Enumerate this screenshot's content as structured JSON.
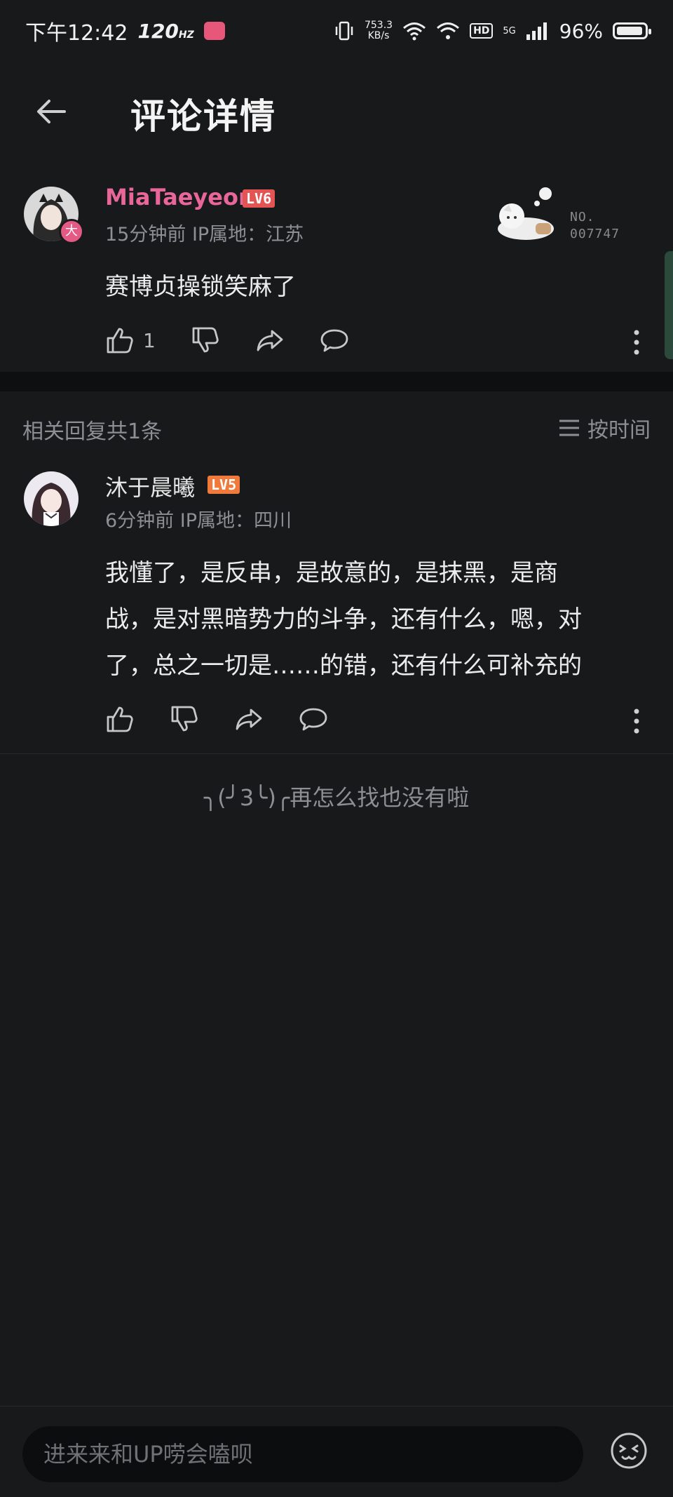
{
  "status_bar": {
    "time": "下午12:42",
    "refresh_rate": "120",
    "refresh_unit": "HZ",
    "net_speed": "753.3",
    "net_unit": "KB/s",
    "hd": "HD",
    "signal": "5G",
    "battery": "96%",
    "battery_level": 0.96
  },
  "header": {
    "title": "评论详情"
  },
  "main_comment": {
    "username": "MiaTaeyeon",
    "level": "LV6",
    "badge": "大",
    "meta": "15分钟前  IP属地：江苏",
    "text": "赛博贞操锁笑麻了",
    "like_count": "1",
    "fan_card_label": "NO.",
    "fan_card_number": "007747"
  },
  "replies_header": {
    "count_text": "相关回复共1条",
    "sort_label": "按时间"
  },
  "reply": {
    "username": "沐于晨曦",
    "level": "LV5",
    "meta": "6分钟前  IP属地：四川",
    "text_line1": "我懂了，是反串，是故意的，是抹黑，是商",
    "text_line2": "战，是对黑暗势力的斗争，还有什么，嗯，对",
    "text_line3": "了，总之一切是……的错，还有什么可补充的"
  },
  "end_tip": "╮(╯3╰)╭再怎么找也没有啦",
  "input": {
    "placeholder": "进来来和UP唠会嗑呗"
  },
  "colors": {
    "background": "#17191b",
    "username_vip": "#e9669b",
    "lv6": "#e35555",
    "lv5": "#ef7a3b"
  }
}
